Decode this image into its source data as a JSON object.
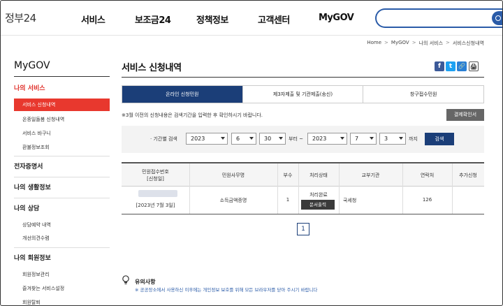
{
  "header": {
    "logo": "정부24",
    "nav": [
      "서비스",
      "보조금24",
      "정책정보",
      "고객센터",
      "MyGOV"
    ],
    "search_placeholder": ""
  },
  "breadcrumb": [
    "Home",
    "MyGOV",
    "나의 서비스",
    "서비스신청내역"
  ],
  "sidebar": {
    "title": "MyGOV",
    "sections": [
      {
        "label": "나의 서비스",
        "items": [
          "서비스 신청내역",
          "온종일돌봄 신청내역",
          "서비스 바구니",
          "환불정보조회"
        ]
      },
      {
        "label": "전자증명서",
        "items": []
      },
      {
        "label": "나의 생활정보",
        "items": []
      },
      {
        "label": "나의 상담",
        "items": [
          "상담예약 내역",
          "개선의견수렴"
        ]
      },
      {
        "label": "나의 회원정보",
        "items": [
          "회원정보관리",
          "즐겨찾는 서비스설정",
          "회원탈퇴"
        ]
      }
    ]
  },
  "main": {
    "title": "서비스 신청내역",
    "share_icons": [
      "f",
      "t",
      "🔗",
      "🖨"
    ],
    "tabs": [
      "온라인 신청민원",
      "제3자제출 및 기관제출(송신)",
      "창구접수민원"
    ],
    "notice": "※3월 이전의 신청내용은 검색기간을 입력한 후 확인하시기 바랍니다.",
    "print_button": "결제확인서",
    "search": {
      "label": "· 기간별 검색",
      "from_year": "2023",
      "from_month": "6",
      "from_day": "30",
      "from_suffix": "부터 ~",
      "to_year": "2023",
      "to_month": "7",
      "to_day": "3",
      "to_suffix": "까지",
      "button": "검색"
    },
    "table": {
      "headers": [
        "민원접수번호\n[신청일]",
        "민원사무명",
        "부수",
        "처리상태",
        "교부기관",
        "연락처",
        "추가신청"
      ],
      "rows": [
        {
          "date": "[2023년 7월 3일]",
          "name": "소득금액증명",
          "copies": "1",
          "status": "처리완료",
          "status_button": "문서출력",
          "agency": "국세청",
          "contact": "126",
          "extra": ""
        }
      ]
    },
    "page": "1",
    "caution": {
      "title": "유의사항",
      "text": "※ 공공장소에서 사용하신 이후에는 개인정보 보호를 위해 모든 브라우저를 닫아 주시기 바랍니다"
    }
  }
}
